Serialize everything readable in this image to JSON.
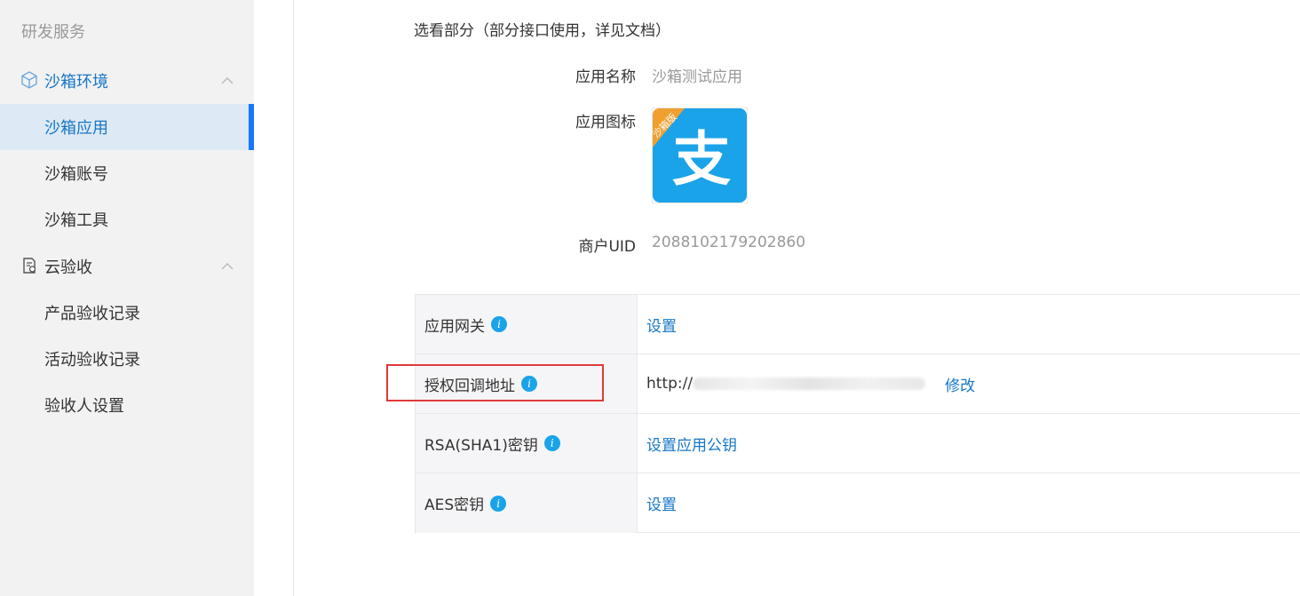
{
  "sidebar": {
    "section_title": "研发服务",
    "groups": [
      {
        "label": "沙箱环境",
        "items": [
          {
            "label": "沙箱应用",
            "active": true
          },
          {
            "label": "沙箱账号",
            "active": false
          },
          {
            "label": "沙箱工具",
            "active": false
          }
        ]
      },
      {
        "label": "云验收",
        "items": [
          {
            "label": "产品验收记录",
            "active": false
          },
          {
            "label": "活动验收记录",
            "active": false
          },
          {
            "label": "验收人设置",
            "active": false
          }
        ]
      }
    ]
  },
  "main": {
    "note": "选看部分（部分接口使用，详见文档）",
    "app_name_label": "应用名称",
    "app_name_value": "沙箱测试应用",
    "app_icon_label": "应用图标",
    "app_icon_badge": "沙箱版",
    "app_icon_glyph": "支",
    "uid_label": "商户UID",
    "uid_value": "2088102179202860"
  },
  "config_rows": [
    {
      "label": "应用网关",
      "value": "设置",
      "kind": "link"
    },
    {
      "label": "授权回调地址",
      "value_prefix": "http://",
      "action": "修改",
      "kind": "url"
    },
    {
      "label": "RSA(SHA1)密钥",
      "value": "设置应用公钥",
      "kind": "link"
    },
    {
      "label": "AES密钥",
      "value": "设置",
      "kind": "link"
    }
  ],
  "info_icon_glyph": "i",
  "colors": {
    "accent": "#1677c8",
    "active_bg": "#dde9f4",
    "alipay_blue": "#1aa3e8",
    "highlight": "#e03a3a"
  }
}
